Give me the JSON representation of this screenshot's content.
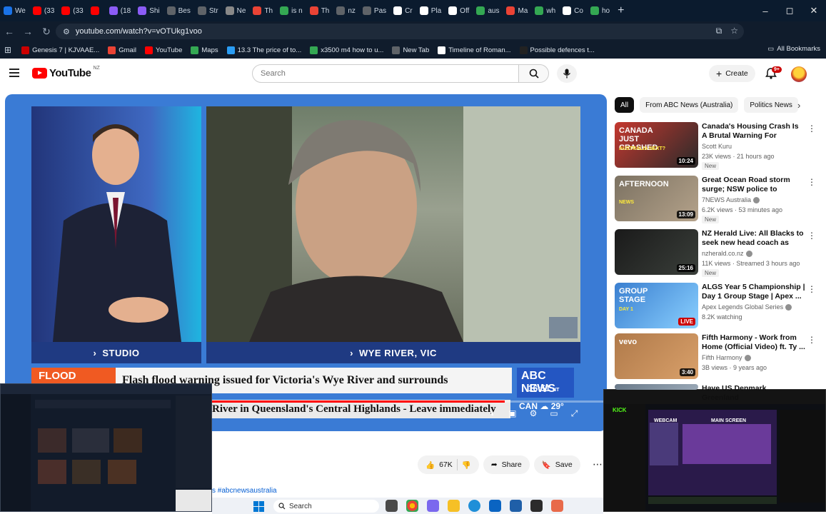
{
  "browser": {
    "tabs": [
      {
        "label": "We",
        "color": "#1a73e8"
      },
      {
        "label": "(33",
        "color": "#ff0000"
      },
      {
        "label": "(33",
        "color": "#ff0000"
      },
      {
        "label": "",
        "color": "#ff0000"
      },
      {
        "label": "(18",
        "color": "#8b5cf6"
      },
      {
        "label": "Shi",
        "color": "#8b5cf6"
      },
      {
        "label": "Bes",
        "color": "#5f6368"
      },
      {
        "label": "Str",
        "color": "#5f6368"
      },
      {
        "label": "Ne",
        "color": "#888888"
      },
      {
        "label": "Th",
        "color": "#ea4335"
      },
      {
        "label": "is n",
        "color": "#34a853"
      },
      {
        "label": "Th",
        "color": "#ea4335"
      },
      {
        "label": "nz",
        "color": "#5f6368"
      },
      {
        "label": "Pas",
        "color": "#5f6368"
      },
      {
        "label": "Cr",
        "color": "#ffffff"
      },
      {
        "label": "Pla",
        "color": "#ffffff"
      },
      {
        "label": "Off",
        "color": "#ffffff"
      },
      {
        "label": "aus",
        "color": "#34a853"
      },
      {
        "label": "Ma",
        "color": "#ea4335"
      },
      {
        "label": "wh",
        "color": "#34a853"
      },
      {
        "label": "Co",
        "color": "#ffffff"
      },
      {
        "label": "ho",
        "color": "#34a853"
      }
    ],
    "new_tab": "+",
    "window_controls": [
      "–",
      "◻",
      "✕"
    ],
    "url": "youtube.com/watch?v=vOTUkg1voo",
    "bookmarks": [
      {
        "label": "Genesis 7 | KJVAAE...",
        "color": "#cc0000"
      },
      {
        "label": "Gmail",
        "color": "#ea4335"
      },
      {
        "label": "YouTube",
        "color": "#ff0000"
      },
      {
        "label": "Maps",
        "color": "#34a853"
      },
      {
        "label": "13.3 The price of to...",
        "color": "#2a9df4"
      },
      {
        "label": "x3500 m4 how to u...",
        "color": "#34a853"
      },
      {
        "label": "New Tab",
        "color": "#5f6368"
      },
      {
        "label": "Timeline of Roman...",
        "color": "#ffffff"
      },
      {
        "label": "Possible defences t...",
        "color": "#222222"
      }
    ],
    "all_bookmarks": "All Bookmarks"
  },
  "header": {
    "logo_text": "YouTube",
    "region": "NZ",
    "search_placeholder": "Search",
    "create_label": "Create",
    "notif_count": "9+"
  },
  "player": {
    "left_label": "STUDIO",
    "right_label": "WYE RIVER, VIC",
    "flood_tag": "FLOOD",
    "headline": "Flash flood warning issued for Victoria's Wye River and surrounds",
    "subline": "River in Queensland's Central Highlands - Leave immediately",
    "abc_brand": "ABC NEWS",
    "time": "16:51",
    "tz": "NT",
    "weather_city": "CAN",
    "weather_temp": "29°",
    "progress": 0.83
  },
  "actions": {
    "likes": "67K",
    "share": "Share",
    "save": "Save"
  },
  "hashtag": "s #abcnewsaustralia",
  "chips": [
    "All",
    "From ABC News (Australia)",
    "Politics News"
  ],
  "recommendations": [
    {
      "title": "Canada's Housing Crash Is A Brutal Warning For Australia ...",
      "channel": "Scott Kuru",
      "meta": "23K views · 21 hours ago",
      "badge": "New",
      "duration": "10:24",
      "thumb_text": "CANADA JUST CRASHED",
      "thumb_sub": "AUSTRALIA NEXT?",
      "verified": false
    },
    {
      "title": "Great Ocean Road storm surge; NSW police to enforce protest ...",
      "channel": "7NEWS Australia",
      "meta": "6.2K views · 53 minutes ago",
      "badge": "New",
      "duration": "13:09",
      "thumb_text": "AFTERNOON",
      "thumb_sub": "NEWS",
      "verified": true
    },
    {
      "title": "NZ Herald Live: All Blacks to seek new head coach as Scott...",
      "channel": "nzherald.co.nz",
      "meta": "11K views · Streamed 3 hours ago",
      "badge": "New",
      "duration": "25:16",
      "thumb_text": "",
      "thumb_sub": "",
      "verified": true
    },
    {
      "title": "ALGS Year 5 Championship | Day 1 Group Stage | Apex ...",
      "channel": "Apex Legends Global Series",
      "meta": "8.2K watching",
      "badge": "",
      "duration": "LIVE",
      "thumb_text": "GROUP STAGE",
      "thumb_sub": "DAY 1",
      "verified": true
    },
    {
      "title": "Fifth Harmony - Work from Home (Official Video) ft. Ty ...",
      "channel": "Fifth Harmony",
      "meta": "3B views · 9 years ago",
      "badge": "",
      "duration": "3:40",
      "thumb_text": "vevo",
      "thumb_sub": "",
      "verified": true
    },
    {
      "title": "Have US Denmark Greenland",
      "channel": "",
      "meta": "",
      "badge": "",
      "duration": "",
      "thumb_text": "",
      "thumb_sub": "",
      "verified": false
    }
  ],
  "overlay_right": {
    "kick": "KICK",
    "webcam": "WEBCAM",
    "main_screen": "MAIN SCREEN"
  },
  "taskbar": {
    "search": "Search"
  }
}
